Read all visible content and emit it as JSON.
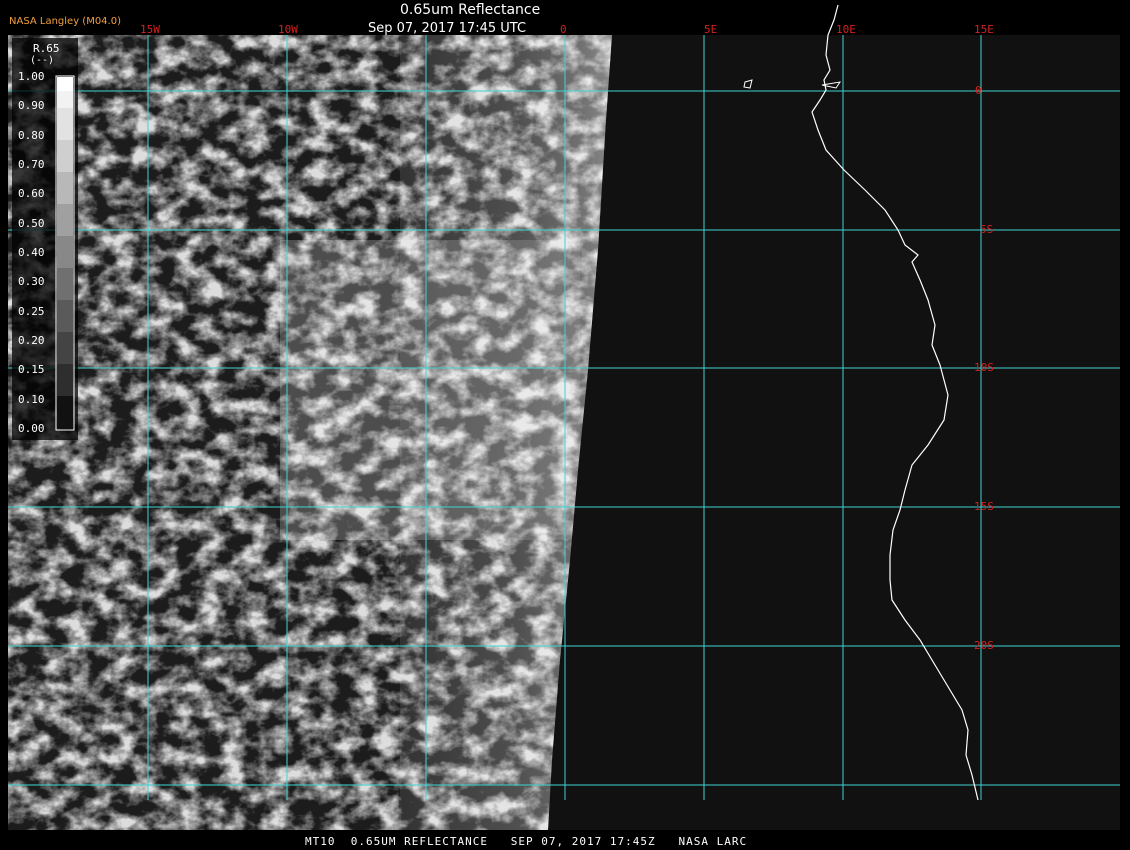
{
  "header": {
    "title": "0.65um Reflectance",
    "subtitle": "Sep 07, 2017 17:45 UTC",
    "badge": "NASA Langley (M04.0)"
  },
  "footer": "MT10  0.65UM REFLECTANCE   SEP 07, 2017 17:45Z   NASA LARC",
  "colorbar": {
    "variable": "R.65",
    "unit": "(--)",
    "ticks": [
      "1.00",
      "0.90",
      "0.80",
      "0.70",
      "0.60",
      "0.50",
      "0.40",
      "0.30",
      "0.25",
      "0.20",
      "0.15",
      "0.10",
      "0.00"
    ]
  },
  "grid": {
    "longitude_labels": [
      "15W",
      "10W",
      "0",
      "5E",
      "10E",
      "15E"
    ],
    "latitude_labels": [
      "0",
      "5S",
      "10S",
      "15S",
      "20S"
    ]
  },
  "colors": {
    "grid": "#3fd3d3",
    "grid_label": "#d42020",
    "coastline": "#ffffff",
    "background": "#000000"
  }
}
